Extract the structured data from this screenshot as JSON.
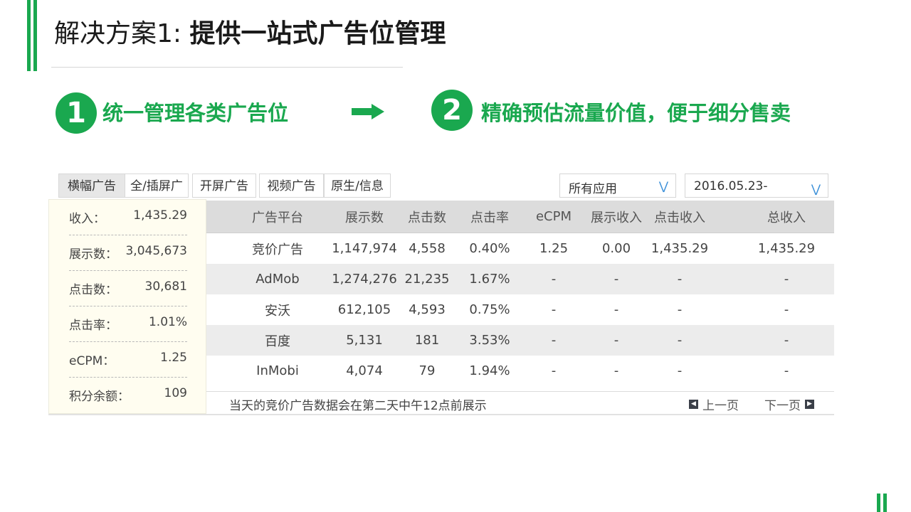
{
  "slide": {
    "title_light": "解决方案1: ",
    "title_bold": "提供一站式广告位管理",
    "step1": {
      "number": "1",
      "text": "统一管理各类广告位"
    },
    "step2": {
      "number": "2",
      "text": "精确预估流量价值，便于细分售卖"
    },
    "accent_color": "#1aa84f"
  },
  "widget": {
    "tabs": [
      {
        "label": "横幅广告",
        "active": true
      },
      {
        "label": "全/插屏广",
        "active": false
      },
      {
        "label": "开屏广告",
        "active": false
      },
      {
        "label": "视频广告",
        "active": false
      },
      {
        "label": "原生/信息",
        "active": false
      }
    ],
    "app_select": {
      "value": "所有应用"
    },
    "date_select": {
      "value": "2016.05.23-"
    },
    "summary": [
      {
        "label": "收入：",
        "value": "1,435.29"
      },
      {
        "label": "展示数：",
        "value": "3,045,673"
      },
      {
        "label": "点击数：",
        "value": "30,681"
      },
      {
        "label": "点击率：",
        "value": "1.01%"
      },
      {
        "label": "eCPM：",
        "value": "1.25"
      },
      {
        "label": "积分余额：",
        "value": "109"
      }
    ],
    "table": {
      "headers": [
        "广告平台",
        "展示数",
        "点击数",
        "点击率",
        "eCPM",
        "展示收入",
        "点击收入",
        "总收入"
      ],
      "rows": [
        [
          "竞价广告",
          "1,147,974",
          "4,558",
          "0.40%",
          "1.25",
          "0.00",
          "1,435.29",
          "1,435.29"
        ],
        [
          "AdMob",
          "1,274,276",
          "21,235",
          "1.67%",
          "-",
          "-",
          "-",
          "-"
        ],
        [
          "安沃",
          "612,105",
          "4,593",
          "0.75%",
          "-",
          "-",
          "-",
          "-"
        ],
        [
          "百度",
          "5,131",
          "181",
          "3.53%",
          "-",
          "-",
          "-",
          "-"
        ],
        [
          "InMobi",
          "4,074",
          "79",
          "1.94%",
          "-",
          "-",
          "-",
          "-"
        ]
      ]
    },
    "footer_note": "当天的竞价广告数据会在第二天中午12点前展示",
    "prev_page": "上一页",
    "next_page": "下一页"
  }
}
